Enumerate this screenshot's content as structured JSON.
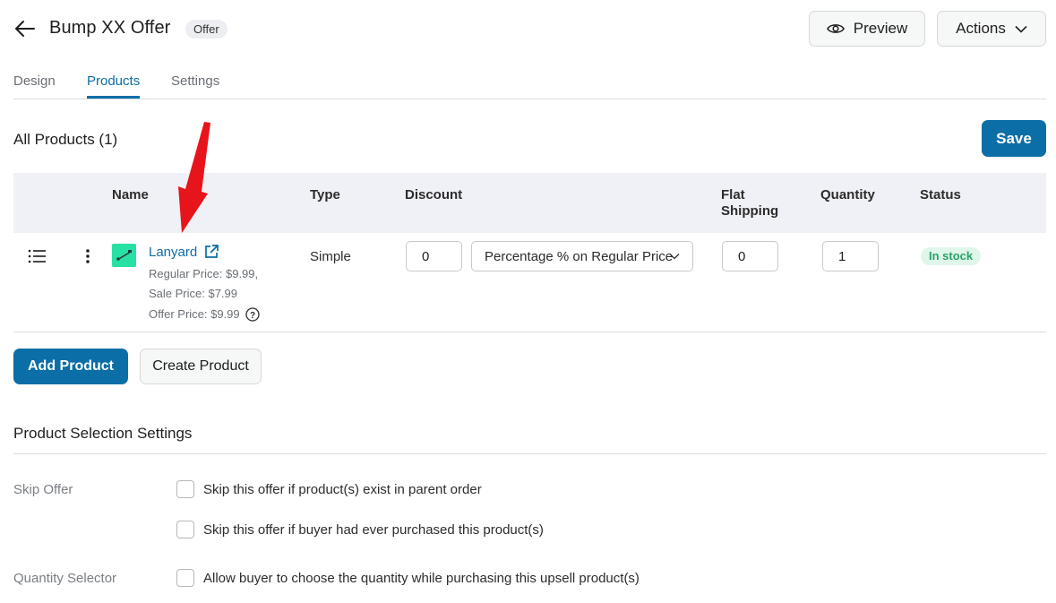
{
  "header": {
    "title": "Bump XX Offer",
    "badge": "Offer",
    "preview_label": "Preview",
    "actions_label": "Actions",
    "icons": [
      "back-arrow-icon",
      "eye-icon",
      "chevron-down-icon"
    ]
  },
  "tabs": [
    {
      "label": "Design",
      "active": false
    },
    {
      "label": "Products",
      "active": true
    },
    {
      "label": "Settings",
      "active": false
    }
  ],
  "products": {
    "title": "All Products (1)",
    "save_label": "Save",
    "columns": [
      "Name",
      "Type",
      "Discount",
      "Flat Shipping",
      "Quantity",
      "Status"
    ],
    "rows": [
      {
        "name": "Lanyard",
        "regular_price": "Regular Price: $9.99,",
        "sale_price": "Sale Price: $7.99",
        "offer_price": "Offer Price: $9.99",
        "type": "Simple",
        "discount_value": "0",
        "discount_type": "Percentage % on Regular Price",
        "flat_shipping": "0",
        "quantity": "1",
        "status": "In stock"
      }
    ],
    "add_product_label": "Add Product",
    "create_product_label": "Create Product"
  },
  "selection_settings": {
    "title": "Product Selection Settings",
    "skip_offer": {
      "label": "Skip Offer",
      "options": [
        {
          "text": "Skip this offer if product(s) exist in parent order",
          "checked": false
        },
        {
          "text": "Skip this offer if buyer had ever purchased this product(s)",
          "checked": false
        }
      ]
    },
    "quantity_selector": {
      "label": "Quantity Selector",
      "options": [
        {
          "text": "Allow buyer to choose the quantity while purchasing this upsell product(s)",
          "checked": false
        }
      ]
    }
  },
  "colors": {
    "primary": "#0b6ea7",
    "stock_badge_bg": "#e0f6ea",
    "stock_badge_text": "#27a36a",
    "annotation_arrow": "#e8141b"
  }
}
